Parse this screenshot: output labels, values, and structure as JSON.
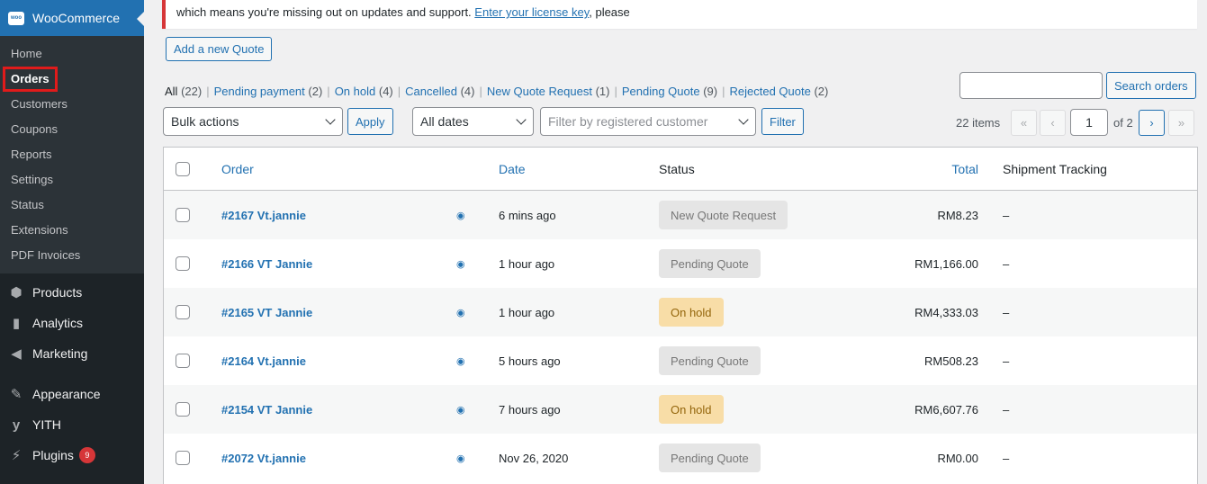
{
  "sidebar": {
    "woocommerce_label": "WooCommerce",
    "logo_text": "woo",
    "submenu": [
      "Home",
      "Orders",
      "Customers",
      "Coupons",
      "Reports",
      "Settings",
      "Status",
      "Extensions",
      "PDF Invoices"
    ],
    "menu": [
      {
        "label": "Products",
        "icon": "cube-icon",
        "glyph": "⬢"
      },
      {
        "label": "Analytics",
        "icon": "bar-chart-icon",
        "glyph": "▮"
      },
      {
        "label": "Marketing",
        "icon": "megaphone-icon",
        "glyph": "◀"
      },
      {
        "label": "Appearance",
        "icon": "paintbrush-icon",
        "glyph": "✎"
      },
      {
        "label": "YITH",
        "icon": "yith-icon",
        "glyph": "y"
      },
      {
        "label": "Plugins",
        "icon": "plug-icon",
        "glyph": "⚡"
      }
    ],
    "plugins_badge": "9"
  },
  "notice": {
    "text_before": "which means you're missing out on updates and support. ",
    "link": "Enter your license key",
    "text_after": ", please"
  },
  "add_quote_label": "Add a new Quote",
  "filters": [
    {
      "label": "All",
      "count": "(22)"
    },
    {
      "label": "Pending payment",
      "count": "(2)"
    },
    {
      "label": "On hold",
      "count": "(4)"
    },
    {
      "label": "Cancelled",
      "count": "(4)"
    },
    {
      "label": "New Quote Request",
      "count": "(1)"
    },
    {
      "label": "Pending Quote",
      "count": "(9)"
    },
    {
      "label": "Rejected Quote",
      "count": "(2)"
    }
  ],
  "search": {
    "button": "Search orders",
    "value": ""
  },
  "toolbar": {
    "bulk_actions": "Bulk actions",
    "apply": "Apply",
    "all_dates": "All dates",
    "customer_placeholder": "Filter by registered customer",
    "filter": "Filter"
  },
  "pagination": {
    "items": "22 items",
    "first": "«",
    "prev": "‹",
    "current": "1",
    "of": "of 2",
    "next": "›",
    "last": "»"
  },
  "table": {
    "headers": {
      "order": "Order",
      "date": "Date",
      "status": "Status",
      "total": "Total",
      "tracking": "Shipment Tracking"
    },
    "rows": [
      {
        "order": "#2167 Vt.jannie",
        "date": "6 mins ago",
        "status": "New Quote Request",
        "status_type": "grey",
        "total": "RM8.23",
        "tracking": "–"
      },
      {
        "order": "#2166 VT Jannie",
        "date": "1 hour ago",
        "status": "Pending Quote",
        "status_type": "grey",
        "total": "RM1,166.00",
        "tracking": "–"
      },
      {
        "order": "#2165 VT Jannie",
        "date": "1 hour ago",
        "status": "On hold",
        "status_type": "hold",
        "total": "RM4,333.03",
        "tracking": "–"
      },
      {
        "order": "#2164 Vt.jannie",
        "date": "5 hours ago",
        "status": "Pending Quote",
        "status_type": "grey",
        "total": "RM508.23",
        "tracking": "–"
      },
      {
        "order": "#2154 VT Jannie",
        "date": "7 hours ago",
        "status": "On hold",
        "status_type": "hold",
        "total": "RM6,607.76",
        "tracking": "–"
      },
      {
        "order": "#2072 Vt.jannie",
        "date": "Nov 26, 2020",
        "status": "Pending Quote",
        "status_type": "grey",
        "total": "RM0.00",
        "tracking": "–"
      }
    ]
  },
  "colors": {
    "accent": "#2271b1",
    "sidebar_bg": "#1d2327",
    "hold_bg": "#f8dda7",
    "grey_bg": "#e5e5e5",
    "highlight_border": "#e01b1b"
  }
}
